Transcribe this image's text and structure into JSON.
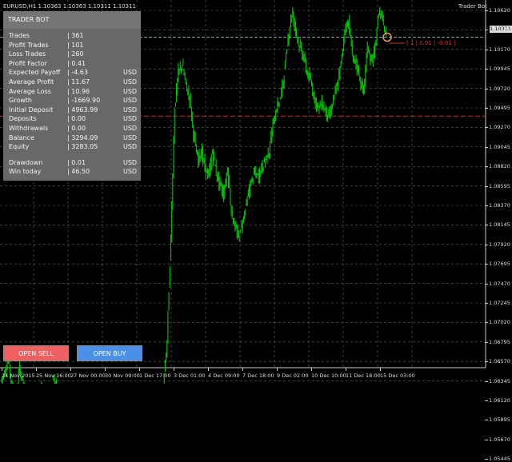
{
  "header": {
    "symbol_info": "EURUSD,H1  1.10363 1.10363 1.10311 1.10311",
    "ea_name": "Trader Bot"
  },
  "panel": {
    "title": "TRADER BOT",
    "rows": [
      {
        "label": "Trades",
        "value": "| 361",
        "unit": ""
      },
      {
        "label": "Profit Trades",
        "value": "| 101",
        "unit": ""
      },
      {
        "label": "Loss Trades",
        "value": "| 260",
        "unit": ""
      },
      {
        "label": "Profit Factor",
        "value": "| 0.41",
        "unit": ""
      },
      {
        "label": "Expected Payoff",
        "value": "| -4.63",
        "unit": "USD"
      },
      {
        "label": "Average Profit",
        "value": "| 11.67",
        "unit": "USD"
      },
      {
        "label": "Average Loss",
        "value": "| 10.96",
        "unit": "USD"
      },
      {
        "label": "Growth",
        "value": "| -1669.90",
        "unit": "USD"
      },
      {
        "label": "Initial Deposit",
        "value": "| 4963.99",
        "unit": "USD"
      },
      {
        "label": "Deposits",
        "value": "| 0.00",
        "unit": "USD"
      },
      {
        "label": "Withdrawals",
        "value": "| 0.00",
        "unit": "USD"
      },
      {
        "label": "Balance",
        "value": "| 3294.09",
        "unit": "USD"
      },
      {
        "label": "Equity",
        "value": "| 3283.05",
        "unit": "USD"
      },
      {
        "label": "Drawdown",
        "value": "| 0.01",
        "unit": "USD"
      },
      {
        "label": "Win today",
        "value": "| 46.50",
        "unit": "USD"
      }
    ]
  },
  "buttons": {
    "sell": "OPEN SELL",
    "buy": "OPEN BUY"
  },
  "trade_label": "[ 1 | 0.01 | -0.01 ]",
  "current_price": "1.10311",
  "colors": {
    "background": "#000000",
    "candles": "#00c800",
    "grid": "#5a6a5a",
    "bid_line": "#6fa3a3",
    "order_line": "#c83030",
    "sell_button": "#f06060",
    "buy_button": "#4a8fe8"
  },
  "chart_data": {
    "type": "line",
    "y_ticks": [
      "1.10620",
      "1.10395",
      "1.10170",
      "1.09945",
      "1.09720",
      "1.09495",
      "1.09270",
      "1.09045",
      "1.08820",
      "1.08595",
      "1.08370",
      "1.08145",
      "1.07920",
      "1.07695",
      "1.07470",
      "1.07245",
      "1.07020",
      "1.06795",
      "1.06570",
      "1.06345",
      "1.06120",
      "1.05895",
      "1.05670",
      "1.05445"
    ],
    "x_ticks": [
      "24 Nov 2015",
      "25 Nov 16:00",
      "27 Nov 00:00",
      "30 Nov 09:00",
      "1 Dec 17:00",
      "3 Dec 01:00",
      "4 Dec 09:00",
      "7 Dec 18:00",
      "9 Dec 02:00",
      "10 Dec 10:00",
      "11 Dec 18:00",
      "15 Dec 03:00"
    ],
    "ylim": [
      1.05445,
      1.1062
    ],
    "price_series": [
      1.0634,
      1.0645,
      1.066,
      1.0628,
      1.0612,
      1.065,
      1.063,
      1.0605,
      1.057,
      1.06,
      1.0618,
      1.0625,
      1.06,
      1.0605,
      1.064,
      1.0625,
      1.061,
      1.062,
      1.0612,
      1.0598,
      1.058,
      1.06,
      1.059,
      1.057,
      1.0582,
      1.056,
      1.0575,
      1.0555,
      1.057,
      1.06,
      1.061,
      1.062,
      1.06,
      1.0585,
      1.0575,
      1.0565,
      1.056,
      1.0552,
      1.054,
      1.053,
      1.0545,
      1.058,
      1.061,
      1.063,
      1.068,
      1.08,
      1.095,
      1.099,
      1.1,
      1.0975,
      1.096,
      1.092,
      1.089,
      1.09,
      1.088,
      1.087,
      1.09,
      1.0875,
      1.086,
      1.085,
      1.088,
      1.083,
      1.081,
      1.08,
      1.082,
      1.084,
      1.086,
      1.0875,
      1.087,
      1.088,
      1.089,
      1.09,
      1.093,
      1.095,
      1.096,
      1.099,
      1.103,
      1.106,
      1.104,
      1.102,
      1.101,
      1.099,
      1.098,
      1.096,
      1.095,
      1.0955,
      1.0945,
      1.094,
      1.096,
      1.0975,
      1.1,
      1.104,
      1.105,
      1.101,
      1.1,
      1.098,
      1.097,
      1.102,
      1.1,
      1.102,
      1.106,
      1.105,
      1.1031
    ],
    "bid_level": 1.10311,
    "order_level": 1.094
  }
}
